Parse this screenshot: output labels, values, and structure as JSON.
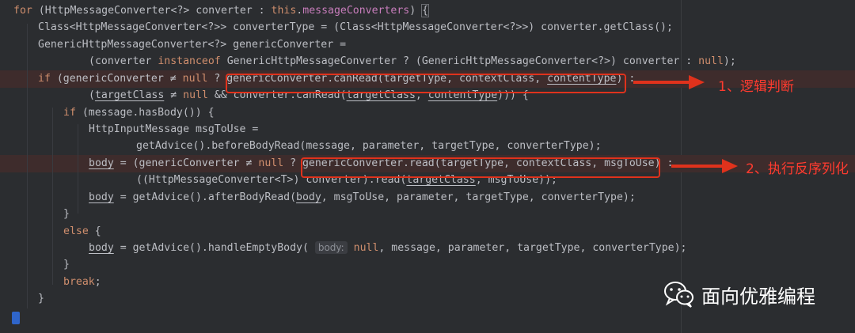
{
  "code_lines": [
    {
      "segments": [
        {
          "t": "for",
          "c": "kw"
        },
        {
          "t": " (HttpMessageConverter<?> converter : "
        },
        {
          "t": "this",
          "c": "kw"
        },
        {
          "t": "."
        },
        {
          "t": "messageConverters",
          "c": "fld"
        },
        {
          "t": ") "
        },
        {
          "t": "{",
          "c": "brace-hl"
        }
      ]
    },
    {
      "segments": [
        {
          "t": "Class<HttpMessageConverter<?>> converterType = (Class<HttpMessageConverter<?>>) converter.getClass();"
        }
      ]
    },
    {
      "segments": [
        {
          "t": "GenericHttpMessageConverter<?> genericConverter ="
        }
      ]
    },
    {
      "segments": [
        {
          "t": "(converter "
        },
        {
          "t": "instanceof",
          "c": "kw"
        },
        {
          "t": " GenericHttpMessageConverter ? (GenericHttpMessageConverter<?>) converter : "
        },
        {
          "t": "null",
          "c": "kw"
        },
        {
          "t": ");"
        }
      ]
    },
    {
      "highlight": true,
      "segments": [
        {
          "t": "if",
          "c": "kw"
        },
        {
          "t": " (genericConverter ≠ "
        },
        {
          "t": "null",
          "c": "kw"
        },
        {
          "t": " ? genericConverter.canRead(targetType, contextClass, "
        },
        {
          "t": "contentType",
          "c": "ul"
        },
        {
          "t": ") :"
        }
      ]
    },
    {
      "segments": [
        {
          "t": "("
        },
        {
          "t": "targetClass",
          "c": "ul"
        },
        {
          "t": " ≠ "
        },
        {
          "t": "null",
          "c": "kw"
        },
        {
          "t": " && converter.canRead("
        },
        {
          "t": "targetClass",
          "c": "ul"
        },
        {
          "t": ", "
        },
        {
          "t": "contentType",
          "c": "ul"
        },
        {
          "t": "))) {"
        }
      ]
    },
    {
      "segments": [
        {
          "t": "if",
          "c": "kw"
        },
        {
          "t": " (message.hasBody()) {"
        }
      ]
    },
    {
      "segments": [
        {
          "t": "HttpInputMessage msgToUse ="
        }
      ]
    },
    {
      "segments": [
        {
          "t": "getAdvice().beforeBodyRead(message, parameter, targetType, converterType);"
        }
      ]
    },
    {
      "highlight": true,
      "segments": [
        {
          "t": "body",
          "c": "ul"
        },
        {
          "t": " = (genericConverter ≠ "
        },
        {
          "t": "null",
          "c": "kw"
        },
        {
          "t": " ? genericConverter.read(targetType, contextClass, msgToUse) :"
        }
      ]
    },
    {
      "segments": [
        {
          "t": "((HttpMessageConverter<T>) converter).read("
        },
        {
          "t": "targetClass",
          "c": "ul"
        },
        {
          "t": ", msgToUse));"
        }
      ]
    },
    {
      "segments": [
        {
          "t": "body",
          "c": "ul"
        },
        {
          "t": " = getAdvice().afterBodyRead("
        },
        {
          "t": "body",
          "c": "ul"
        },
        {
          "t": ", msgToUse, parameter, targetType, converterType);"
        }
      ]
    },
    {
      "segments": [
        {
          "t": "}"
        }
      ]
    },
    {
      "segments": [
        {
          "t": "else",
          "c": "kw"
        },
        {
          "t": " {"
        }
      ]
    },
    {
      "segments": [
        {
          "t": "body",
          "c": "ul"
        },
        {
          "t": " = getAdvice().handleEmptyBody( "
        },
        {
          "t": "body:",
          "c": "hint"
        },
        {
          "t": " "
        },
        {
          "t": "null",
          "c": "kw"
        },
        {
          "t": ", message, parameter, targetType, converterType);"
        }
      ]
    },
    {
      "segments": [
        {
          "t": "}"
        }
      ]
    },
    {
      "segments": [
        {
          "t": "break",
          "c": "kw"
        },
        {
          "t": ";"
        }
      ]
    },
    {
      "segments": [
        {
          "t": "}"
        }
      ]
    }
  ],
  "annotations": [
    {
      "label": "1、逻辑判断"
    },
    {
      "label": "2、执行反序列化"
    }
  ],
  "watermark": {
    "text": "面向优雅编程",
    "icon": "wechat-icon"
  },
  "colors": {
    "background": "#2b2d30",
    "keyword": "#cf8e6d",
    "field": "#c77dbb",
    "text": "#bcbec4",
    "annotation": "#ff3b2f",
    "box": "#e0321c"
  }
}
